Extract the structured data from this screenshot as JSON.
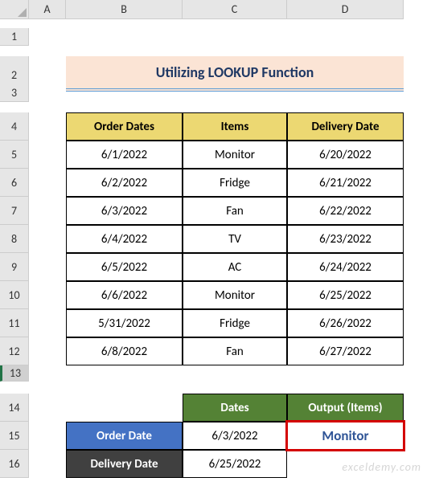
{
  "columns": [
    "",
    "A",
    "B",
    "C",
    "D"
  ],
  "rows": [
    "1",
    "2",
    "3",
    "4",
    "5",
    "6",
    "7",
    "8",
    "9",
    "10",
    "11",
    "12",
    "13",
    "14",
    "15",
    "16"
  ],
  "title": "Utilizing LOOKUP Function",
  "tableHeaders": {
    "b": "Order Dates",
    "c": "Items",
    "d": "Delivery Date"
  },
  "table": [
    {
      "b": "6/1/2022",
      "c": "Monitor",
      "d": "6/20/2022"
    },
    {
      "b": "6/2/2022",
      "c": "Fridge",
      "d": "6/21/2022"
    },
    {
      "b": "6/3/2022",
      "c": "Fan",
      "d": "6/22/2022"
    },
    {
      "b": "6/4/2022",
      "c": "TV",
      "d": "6/23/2022"
    },
    {
      "b": "6/5/2022",
      "c": "AC",
      "d": "6/24/2022"
    },
    {
      "b": "6/6/2022",
      "c": "Monitor",
      "d": "6/25/2022"
    },
    {
      "b": "5/31/2022",
      "c": "Fridge",
      "d": "6/26/2022"
    },
    {
      "b": "6/8/2022",
      "c": "Fan",
      "d": "6/27/2022"
    }
  ],
  "lookup": {
    "headDates": "Dates",
    "headOutput": "Output (Items)",
    "orderLabel": "Order Date",
    "orderValue": "6/3/2022",
    "outputValue": "Monitor",
    "deliveryLabel": "Delivery Date",
    "deliveryValue": "6/25/2022"
  },
  "watermark": "exceldemy.com",
  "selectedRow": "13"
}
